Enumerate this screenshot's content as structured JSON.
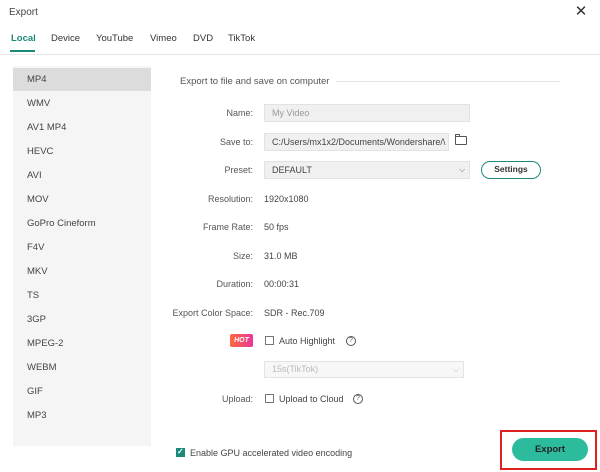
{
  "window": {
    "title": "Export"
  },
  "tabs": [
    {
      "label": "Local",
      "active": true
    },
    {
      "label": "Device"
    },
    {
      "label": "YouTube"
    },
    {
      "label": "Vimeo"
    },
    {
      "label": "DVD"
    },
    {
      "label": "TikTok"
    }
  ],
  "formats": [
    "MP4",
    "WMV",
    "AV1 MP4",
    "HEVC",
    "AVI",
    "MOV",
    "GoPro Cineform",
    "F4V",
    "MKV",
    "TS",
    "3GP",
    "MPEG-2",
    "WEBM",
    "GIF",
    "MP3"
  ],
  "selected_format": "MP4",
  "section_title": "Export to file and save on computer",
  "form": {
    "name_label": "Name:",
    "name_value": "My Video",
    "saveto_label": "Save to:",
    "saveto_value": "C:/Users/mx1x2/Documents/Wondershare/\\",
    "preset_label": "Preset:",
    "preset_value": "DEFAULT",
    "settings_label": "Settings",
    "resolution_label": "Resolution:",
    "resolution_value": "1920x1080",
    "framerate_label": "Frame Rate:",
    "framerate_value": "50 fps",
    "size_label": "Size:",
    "size_value": "31.0 MB",
    "duration_label": "Duration:",
    "duration_value": "00:00:31",
    "colorspace_label": "Export Color Space:",
    "colorspace_value": "SDR - Rec.709",
    "hot_badge": "HOT",
    "auto_highlight_label": "Auto Highlight",
    "highlight_select_value": "15s(TikTok)",
    "upload_label": "Upload:",
    "upload_cloud_label": "Upload to Cloud"
  },
  "footer": {
    "gpu_label": "Enable GPU accelerated video encoding",
    "gpu_checked": true,
    "export_label": "Export"
  },
  "colors": {
    "accent": "#1d8a79",
    "export_button": "#2dbb9d",
    "highlight_border": "#e02020"
  }
}
